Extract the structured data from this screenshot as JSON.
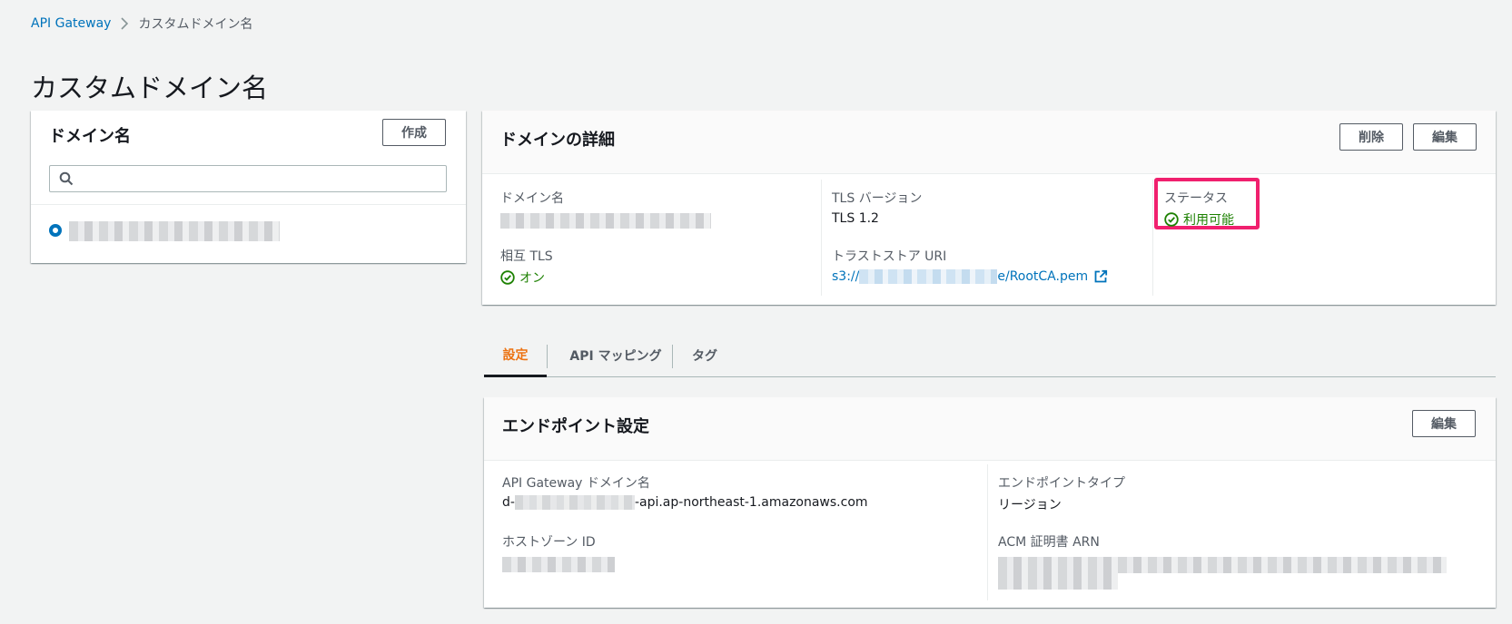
{
  "breadcrumb": {
    "root": "API Gateway",
    "separator": ">",
    "current": "カスタムドメイン名"
  },
  "page_title": "カスタムドメイン名",
  "left_panel": {
    "title": "ドメイン名",
    "create_button": "作成",
    "search_placeholder": ""
  },
  "details": {
    "title": "ドメインの詳細",
    "delete_button": "削除",
    "edit_button": "編集",
    "domain_name_label": "ドメイン名",
    "mutual_tls_label": "相互 TLS",
    "mutual_tls_value": "オン",
    "tls_version_label": "TLS バージョン",
    "tls_version_value": "TLS 1.2",
    "truststore_label": "トラストストア URI",
    "truststore_prefix": "s3://",
    "truststore_suffix": "e/RootCA.pem",
    "status_label": "ステータス",
    "status_value": "利用可能"
  },
  "tabs": [
    {
      "label": "設定",
      "active": true
    },
    {
      "label": "API マッピング",
      "active": false
    },
    {
      "label": "タグ",
      "active": false
    }
  ],
  "endpoint": {
    "title": "エンドポイント設定",
    "edit_button": "編集",
    "apigw_domain_label": "API Gateway ドメイン名",
    "apigw_domain_prefix": "d-",
    "apigw_domain_suffix": "-api.ap-northeast-1.amazonaws.com",
    "hosted_zone_label": "ホストゾーン ID",
    "endpoint_type_label": "エンドポイントタイプ",
    "endpoint_type_value": "リージョン",
    "acm_arn_label": "ACM 証明書 ARN"
  },
  "colors": {
    "link": "#0073bb",
    "success": "#1d8102",
    "active_tab": "#ec7211",
    "highlight": "#f0206e"
  }
}
